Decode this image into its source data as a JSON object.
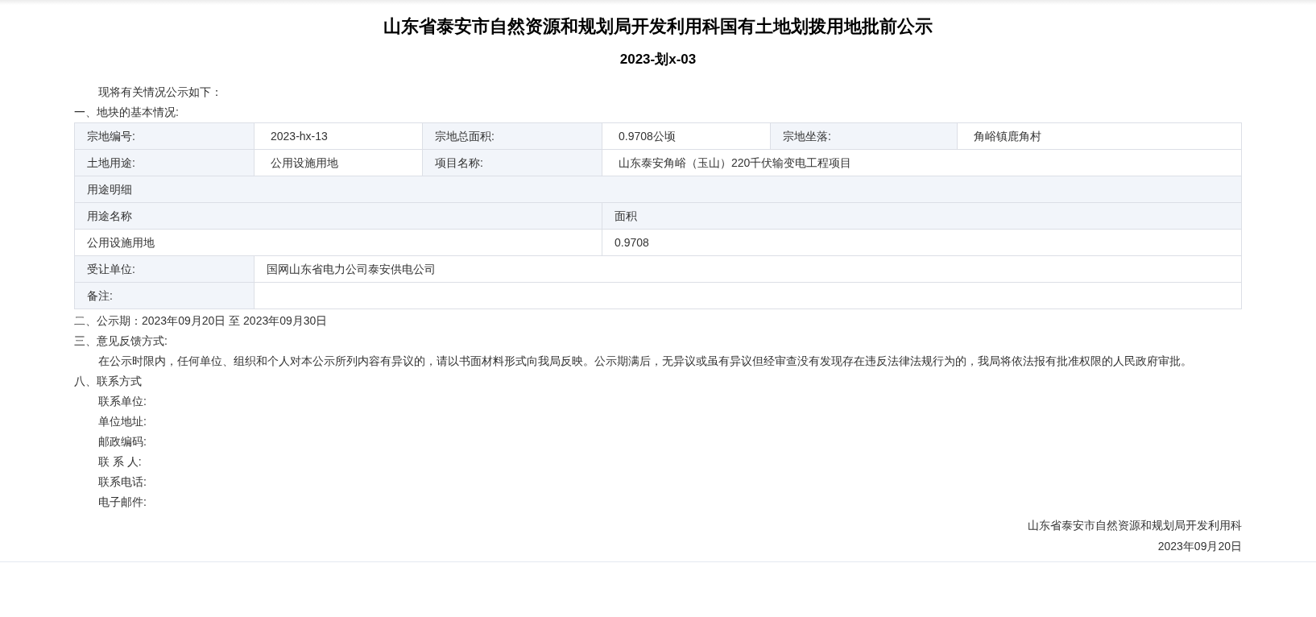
{
  "title": "山东省泰安市自然资源和规划局开发利用科国有土地划拨用地批前公示",
  "subtitle": "2023-划x-03",
  "intro": "现将有关情况公示如下：",
  "section_1": "一、地块的基本情况:",
  "table": {
    "rows": [
      {
        "kind": "fields",
        "items": [
          {
            "label": "宗地编号:",
            "value": "2023-hx-13"
          },
          {
            "label": "宗地总面积:",
            "value": "0.9708公顷"
          },
          {
            "label": "宗地坐落:",
            "value": "角峪镇鹿角村"
          }
        ]
      },
      {
        "kind": "fields",
        "items": [
          {
            "label": "土地用途:",
            "value": "公用设施用地"
          },
          {
            "label": "项目名称:",
            "value": "山东泰安角峪（玉山）220千伏输变电工程项目"
          }
        ]
      },
      {
        "kind": "section",
        "text": "用途明细"
      },
      {
        "kind": "detail_header",
        "cells": [
          "用途名称",
          "面积"
        ]
      },
      {
        "kind": "detail_row",
        "cells": [
          "公用设施用地",
          "0.9708"
        ]
      },
      {
        "kind": "fields",
        "items": [
          {
            "label": "受让单位:",
            "value": "国网山东省电力公司泰安供电公司"
          }
        ]
      },
      {
        "kind": "fields",
        "items": [
          {
            "label": "备注:"
          }
        ]
      }
    ]
  },
  "section_2": "二、公示期：2023年09月20日 至 2023年09月30日",
  "section_3": "三、意见反馈方式:",
  "feedback": "在公示时限内，任何单位、组织和个人对本公示所列内容有异议的，请以书面材料形式向我局反映。公示期满后，无异议或虽有异议但经审查没有发现存在违反法律法规行为的，我局将依法报有批准权限的人民政府审批。",
  "section_8": "八、联系方式",
  "contacts": [
    "联系单位:",
    "单位地址:",
    "邮政编码:",
    "联 系 人:",
    "联系电话:",
    "电子邮件:"
  ],
  "footer": {
    "issuer": "山东省泰安市自然资源和规划局开发利用科",
    "date": "2023年09月20日"
  }
}
